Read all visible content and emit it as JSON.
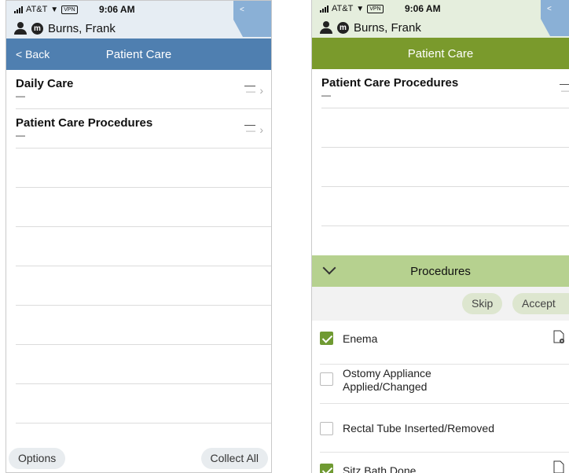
{
  "status": {
    "carrier": "AT&T",
    "vpn": "VPN",
    "time": "9:06 AM"
  },
  "patient": {
    "name": "Burns, Frank",
    "badge": "m"
  },
  "left": {
    "back_label": "< Back",
    "title": "Patient Care",
    "rows": [
      {
        "title": "Daily Care",
        "sub": "—",
        "value": "—"
      },
      {
        "title": "Patient Care Procedures",
        "sub": "—",
        "value": "—"
      }
    ],
    "options_label": "Options",
    "collect_label": "Collect All"
  },
  "right": {
    "title": "Patient Care",
    "row": {
      "title": "Patient Care Procedures",
      "sub": "—",
      "value": "—"
    },
    "section_title": "Procedures",
    "skip_label": "Skip",
    "accept_label": "Accept",
    "procedures": [
      {
        "label": "Enema",
        "checked": true,
        "has_doc": true
      },
      {
        "label": "Ostomy Appliance\nApplied/Changed",
        "checked": false,
        "has_doc": false
      },
      {
        "label": "Rectal Tube Inserted/Removed",
        "checked": false,
        "has_doc": false
      },
      {
        "label": "Sitz Bath Done",
        "checked": true,
        "has_doc": true
      }
    ]
  }
}
